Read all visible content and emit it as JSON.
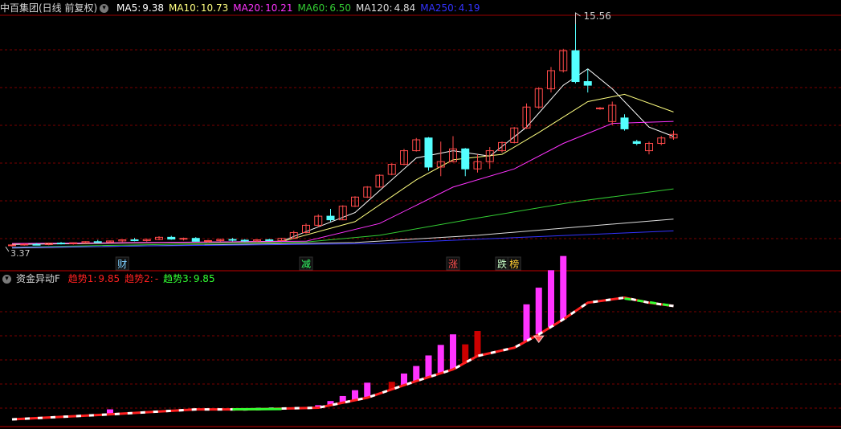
{
  "main_panel": {
    "title": "中百集团(日线 前复权)",
    "legend": [
      {
        "label": "MA5:",
        "value": "9.38",
        "color": "#ffffff"
      },
      {
        "label": "MA10:",
        "value": "10.73",
        "color": "#ffff80"
      },
      {
        "label": "MA20:",
        "value": "10.21",
        "color": "#ff33ff"
      },
      {
        "label": "MA60:",
        "value": "6.50",
        "color": "#33cc33"
      },
      {
        "label": "MA120:",
        "value": "4.84",
        "color": "#dddddd"
      },
      {
        "label": "MA250:",
        "value": "4.19",
        "color": "#3333ff"
      }
    ],
    "high_label": "15.56",
    "low_label": "3.37",
    "events": [
      {
        "text": "财",
        "color": "#7fd0ff",
        "index": 9
      },
      {
        "text": "减",
        "color": "#33ff66",
        "index": 24
      },
      {
        "text": "涨",
        "color": "#ff5050",
        "index": 36
      },
      {
        "text": "跌",
        "color": "#c8ffc8",
        "index": 40
      },
      {
        "text": "榜",
        "color": "#ffcc33",
        "index": 41
      }
    ]
  },
  "indicator_panel": {
    "title": "资金异动F",
    "legend": [
      {
        "label": "趋势1:",
        "value": "9.85",
        "color": "#ff2020"
      },
      {
        "label": "趋势2:",
        "value": "-",
        "color": "#ff2020"
      },
      {
        "label": "趋势3:",
        "value": "9.85",
        "color": "#33ff33"
      }
    ]
  },
  "colors": {
    "up": "#ff4a4a",
    "down": "#54ffff",
    "grid": "#7a0000",
    "background": "#000000"
  },
  "chart_data": {
    "type": "candlestick",
    "price_range": [
      3.37,
      15.56
    ],
    "candles": [
      [
        3.4,
        3.45,
        3.32,
        3.42
      ],
      [
        3.42,
        3.5,
        3.38,
        3.46
      ],
      [
        3.45,
        3.52,
        3.4,
        3.43
      ],
      [
        3.44,
        3.55,
        3.4,
        3.52
      ],
      [
        3.52,
        3.58,
        3.45,
        3.48
      ],
      [
        3.48,
        3.56,
        3.44,
        3.54
      ],
      [
        3.54,
        3.62,
        3.5,
        3.6
      ],
      [
        3.6,
        3.7,
        3.55,
        3.58
      ],
      [
        3.58,
        3.66,
        3.52,
        3.64
      ],
      [
        3.64,
        3.72,
        3.58,
        3.7
      ],
      [
        3.7,
        3.8,
        3.62,
        3.66
      ],
      [
        3.66,
        3.74,
        3.6,
        3.72
      ],
      [
        3.72,
        3.9,
        3.68,
        3.84
      ],
      [
        3.84,
        3.92,
        3.7,
        3.74
      ],
      [
        3.74,
        3.82,
        3.66,
        3.78
      ],
      [
        3.78,
        3.85,
        3.6,
        3.62
      ],
      [
        3.62,
        3.7,
        3.55,
        3.66
      ],
      [
        3.66,
        3.76,
        3.6,
        3.72
      ],
      [
        3.72,
        3.8,
        3.62,
        3.68
      ],
      [
        3.68,
        3.74,
        3.58,
        3.64
      ],
      [
        3.64,
        3.72,
        3.58,
        3.7
      ],
      [
        3.7,
        3.76,
        3.64,
        3.66
      ],
      [
        3.66,
        3.8,
        3.62,
        3.78
      ],
      [
        3.78,
        4.2,
        3.74,
        4.1
      ],
      [
        4.1,
        4.6,
        4.05,
        4.5
      ],
      [
        4.5,
        5.1,
        4.4,
        5.0
      ],
      [
        5.0,
        5.4,
        4.7,
        4.8
      ],
      [
        4.8,
        5.6,
        4.78,
        5.55
      ],
      [
        5.55,
        6.1,
        5.5,
        6.05
      ],
      [
        6.05,
        6.65,
        6.0,
        6.6
      ],
      [
        6.6,
        7.3,
        6.58,
        7.25
      ],
      [
        7.3,
        7.9,
        7.25,
        7.85
      ],
      [
        7.85,
        8.7,
        7.8,
        8.6
      ],
      [
        8.6,
        9.3,
        8.55,
        9.2
      ],
      [
        9.3,
        9.35,
        7.5,
        7.7
      ],
      [
        7.7,
        9.1,
        7.2,
        8.0
      ],
      [
        8.0,
        9.4,
        7.95,
        8.7
      ],
      [
        8.7,
        8.75,
        7.2,
        7.6
      ],
      [
        7.6,
        8.4,
        7.4,
        8.0
      ],
      [
        8.0,
        8.8,
        7.6,
        8.6
      ],
      [
        8.6,
        9.1,
        8.5,
        9.05
      ],
      [
        9.05,
        9.9,
        9.0,
        9.85
      ],
      [
        9.85,
        11.2,
        9.8,
        11.0
      ],
      [
        11.0,
        12.1,
        10.9,
        12.0
      ],
      [
        12.0,
        13.2,
        11.8,
        13.0
      ],
      [
        13.0,
        14.2,
        12.9,
        14.1
      ],
      [
        14.1,
        15.56,
        12.3,
        12.4
      ],
      [
        12.4,
        13.1,
        11.8,
        12.2
      ],
      [
        10.9,
        11.0,
        10.85,
        10.95
      ],
      [
        10.2,
        11.3,
        10.0,
        11.1
      ],
      [
        10.4,
        10.6,
        9.7,
        9.8
      ],
      [
        9.1,
        9.2,
        8.9,
        9.0
      ],
      [
        8.6,
        9.1,
        8.4,
        9.0
      ],
      [
        9.0,
        9.4,
        8.9,
        9.3
      ],
      [
        9.3,
        9.7,
        9.2,
        9.5
      ]
    ],
    "ma_series": [
      {
        "name": "MA5",
        "color": "#ffffff",
        "points": [
          [
            0,
            3.45
          ],
          [
            22,
            3.62
          ],
          [
            28,
            5.2
          ],
          [
            33,
            8.2
          ],
          [
            36,
            8.6
          ],
          [
            39,
            8.3
          ],
          [
            42,
            9.9
          ],
          [
            45,
            12.2
          ],
          [
            47,
            13.1
          ],
          [
            49,
            12.0
          ],
          [
            52,
            9.9
          ],
          [
            54,
            9.38
          ]
        ]
      },
      {
        "name": "MA10",
        "color": "#ffff80",
        "points": [
          [
            0,
            3.48
          ],
          [
            22,
            3.6
          ],
          [
            28,
            4.7
          ],
          [
            33,
            7.0
          ],
          [
            36,
            8.1
          ],
          [
            40,
            8.4
          ],
          [
            43,
            9.6
          ],
          [
            47,
            11.3
          ],
          [
            50,
            11.7
          ],
          [
            54,
            10.73
          ]
        ]
      },
      {
        "name": "MA20",
        "color": "#ff33ff",
        "points": [
          [
            0,
            3.5
          ],
          [
            24,
            3.62
          ],
          [
            30,
            4.6
          ],
          [
            36,
            6.6
          ],
          [
            41,
            7.6
          ],
          [
            45,
            9.0
          ],
          [
            49,
            10.1
          ],
          [
            54,
            10.21
          ]
        ]
      },
      {
        "name": "MA60",
        "color": "#33cc33",
        "points": [
          [
            0,
            3.3
          ],
          [
            24,
            3.58
          ],
          [
            30,
            3.95
          ],
          [
            38,
            4.9
          ],
          [
            46,
            5.8
          ],
          [
            54,
            6.5
          ]
        ]
      },
      {
        "name": "MA120",
        "color": "#dddddd",
        "points": [
          [
            0,
            3.25
          ],
          [
            28,
            3.55
          ],
          [
            38,
            3.95
          ],
          [
            46,
            4.4
          ],
          [
            54,
            4.84
          ]
        ]
      },
      {
        "name": "MA250",
        "color": "#3333ff",
        "points": [
          [
            0,
            3.28
          ],
          [
            30,
            3.5
          ],
          [
            42,
            3.85
          ],
          [
            54,
            4.19
          ]
        ]
      }
    ],
    "indicator": {
      "bars": [
        {
          "index": 8,
          "value": 0.6,
          "color": "#ff33ff"
        },
        {
          "index": 25,
          "value": 0.3,
          "color": "#ff33ff"
        },
        {
          "index": 26,
          "value": 0.5,
          "color": "#ff33ff"
        },
        {
          "index": 27,
          "value": 0.8,
          "color": "#ff33ff"
        },
        {
          "index": 28,
          "value": 1.2,
          "color": "#ff33ff"
        },
        {
          "index": 29,
          "value": 1.8,
          "color": "#ff33ff"
        },
        {
          "index": 31,
          "value": 0.9,
          "color": "#cc0000"
        },
        {
          "index": 32,
          "value": 1.4,
          "color": "#ff33ff"
        },
        {
          "index": 33,
          "value": 1.8,
          "color": "#ff33ff"
        },
        {
          "index": 34,
          "value": 2.6,
          "color": "#ff33ff"
        },
        {
          "index": 35,
          "value": 3.4,
          "color": "#ff33ff"
        },
        {
          "index": 36,
          "value": 4.2,
          "color": "#ff33ff"
        },
        {
          "index": 37,
          "value": 2.2,
          "color": "#cc0000"
        },
        {
          "index": 38,
          "value": 3.0,
          "color": "#cc0000"
        },
        {
          "index": 42,
          "value": 4.4,
          "color": "#ff33ff"
        },
        {
          "index": 43,
          "value": 5.6,
          "color": "#ff33ff"
        },
        {
          "index": 44,
          "value": 6.8,
          "color": "#ff33ff"
        },
        {
          "index": 45,
          "value": 7.6,
          "color": "#ff33ff"
        }
      ],
      "line": [
        [
          0,
          0.0
        ],
        [
          8,
          0.3
        ],
        [
          15,
          0.6
        ],
        [
          19,
          0.6
        ],
        [
          25,
          0.7
        ],
        [
          29,
          1.3
        ],
        [
          33,
          2.3
        ],
        [
          36,
          3.0
        ],
        [
          38,
          3.8
        ],
        [
          41,
          4.3
        ],
        [
          43,
          5.1
        ],
        [
          45,
          6.0
        ],
        [
          47,
          7.0
        ],
        [
          50,
          7.3
        ],
        [
          52,
          7.0
        ],
        [
          54,
          6.8
        ]
      ],
      "signal_index": 43
    }
  }
}
